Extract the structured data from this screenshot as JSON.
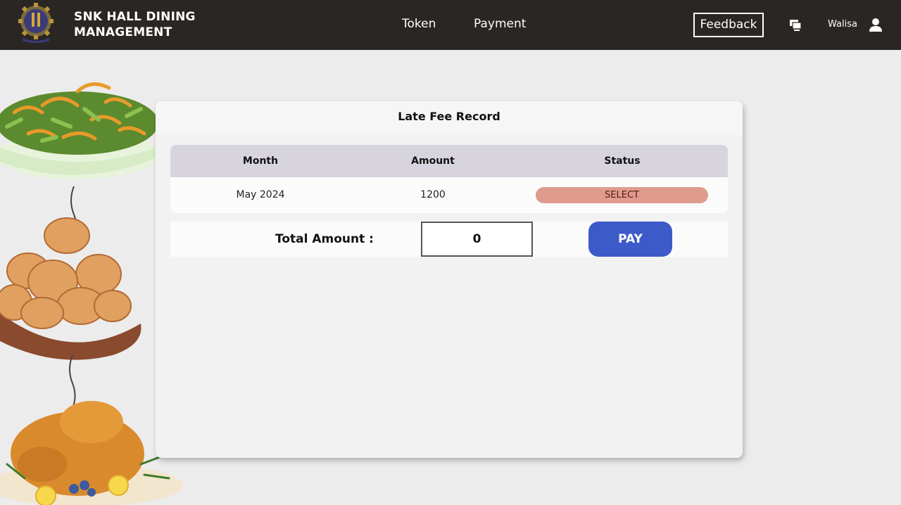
{
  "navbar": {
    "brand_line1": "SNK HALL DINING",
    "brand_line2": "MANAGEMENT",
    "links": [
      {
        "label": "Token"
      },
      {
        "label": "Payment"
      }
    ],
    "feedback_label": "Feedback",
    "username": "Walisa",
    "icons": {
      "logo": "university-crest-logo",
      "screen": "monitor-icon",
      "user": "user-icon"
    },
    "background_color": "#2a2624"
  },
  "card": {
    "title": "Late Fee Record",
    "table": {
      "columns": [
        "Month",
        "Amount",
        "Status"
      ],
      "rows": [
        {
          "month": "May 2024",
          "amount": "1200",
          "status_action": "SELECT"
        }
      ]
    },
    "total_label": "Total Amount :",
    "total_value": "0",
    "pay_label": "PAY"
  },
  "colors": {
    "header_row": "#d8d4de",
    "select_button": "#df9b8e",
    "pay_button": "#3d5bc8"
  }
}
